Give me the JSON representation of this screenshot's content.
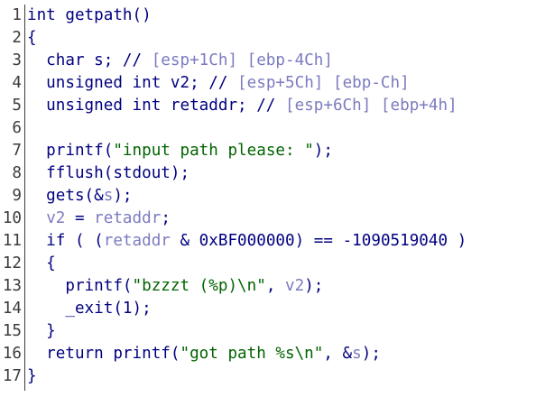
{
  "editor": {
    "lines": [
      {
        "num": "1",
        "tokens": [
          {
            "t": "int getpath()",
            "k": "plain"
          }
        ]
      },
      {
        "num": "2",
        "tokens": [
          {
            "t": "{",
            "k": "plain"
          }
        ]
      },
      {
        "num": "3",
        "tokens": [
          {
            "t": "  char s; // ",
            "k": "plain"
          },
          {
            "t": "[esp+1Ch] [ebp-4Ch]",
            "k": "cmt"
          }
        ]
      },
      {
        "num": "4",
        "tokens": [
          {
            "t": "  unsigned int v2; // ",
            "k": "plain"
          },
          {
            "t": "[esp+5Ch] [ebp-Ch]",
            "k": "cmt"
          }
        ]
      },
      {
        "num": "5",
        "tokens": [
          {
            "t": "  unsigned int retaddr; // ",
            "k": "plain"
          },
          {
            "t": "[esp+6Ch] [ebp+4h]",
            "k": "cmt"
          }
        ]
      },
      {
        "num": "6",
        "tokens": [
          {
            "t": "",
            "k": "plain"
          }
        ]
      },
      {
        "num": "7",
        "tokens": [
          {
            "t": "  printf(",
            "k": "plain"
          },
          {
            "t": "\"input path please: \"",
            "k": "str"
          },
          {
            "t": ");",
            "k": "plain"
          }
        ]
      },
      {
        "num": "8",
        "tokens": [
          {
            "t": "  fflush(stdout);",
            "k": "plain"
          }
        ]
      },
      {
        "num": "9",
        "tokens": [
          {
            "t": "  gets(&",
            "k": "plain"
          },
          {
            "t": "s",
            "k": "var"
          },
          {
            "t": ");",
            "k": "plain"
          }
        ]
      },
      {
        "num": "10",
        "tokens": [
          {
            "t": "  ",
            "k": "plain"
          },
          {
            "t": "v2",
            "k": "var"
          },
          {
            "t": " = ",
            "k": "plain"
          },
          {
            "t": "retaddr",
            "k": "var"
          },
          {
            "t": ";",
            "k": "plain"
          }
        ]
      },
      {
        "num": "11",
        "tokens": [
          {
            "t": "  if ( (",
            "k": "plain"
          },
          {
            "t": "retaddr",
            "k": "var"
          },
          {
            "t": " & 0xBF000000) == -1090519040 )",
            "k": "plain"
          }
        ]
      },
      {
        "num": "12",
        "tokens": [
          {
            "t": "  {",
            "k": "plain"
          }
        ]
      },
      {
        "num": "13",
        "tokens": [
          {
            "t": "    printf(",
            "k": "plain"
          },
          {
            "t": "\"bzzzt (%p)\\n\"",
            "k": "str"
          },
          {
            "t": ", ",
            "k": "plain"
          },
          {
            "t": "v2",
            "k": "var"
          },
          {
            "t": ");",
            "k": "plain"
          }
        ]
      },
      {
        "num": "14",
        "tokens": [
          {
            "t": "    _exit(1);",
            "k": "plain"
          }
        ]
      },
      {
        "num": "15",
        "tokens": [
          {
            "t": "  }",
            "k": "plain"
          }
        ]
      },
      {
        "num": "16",
        "tokens": [
          {
            "t": "  return printf(",
            "k": "plain"
          },
          {
            "t": "\"got path %s\\n\"",
            "k": "str"
          },
          {
            "t": ", &",
            "k": "plain"
          },
          {
            "t": "s",
            "k": "var"
          },
          {
            "t": ");",
            "k": "plain"
          }
        ]
      },
      {
        "num": "17",
        "tokens": [
          {
            "t": "}",
            "k": "plain"
          }
        ]
      }
    ]
  },
  "colors": {
    "plain": "#000080",
    "string": "#006400",
    "variable": "#7b7bc0",
    "comment": "#7b7bc0",
    "line_number": "#3c3c3c",
    "background": "#ffffff"
  }
}
